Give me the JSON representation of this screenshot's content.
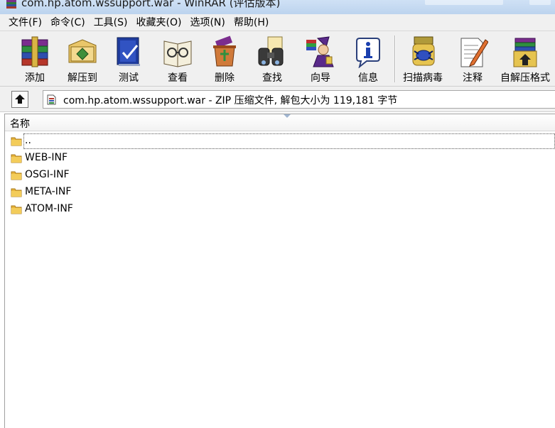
{
  "window": {
    "title": "com.hp.atom.wssupport.war - WinRAR (评估版本)"
  },
  "menu": {
    "items": [
      {
        "label": "文件(F)"
      },
      {
        "label": "命令(C)"
      },
      {
        "label": "工具(S)"
      },
      {
        "label": "收藏夹(O)"
      },
      {
        "label": "选项(N)"
      },
      {
        "label": "帮助(H)"
      }
    ]
  },
  "toolbar": {
    "buttons": [
      {
        "label": "添加",
        "icon": "add-archive-icon"
      },
      {
        "label": "解压到",
        "icon": "extract-to-icon"
      },
      {
        "label": "测试",
        "icon": "test-icon"
      },
      {
        "label": "查看",
        "icon": "view-icon"
      },
      {
        "label": "删除",
        "icon": "delete-icon"
      },
      {
        "label": "查找",
        "icon": "find-icon"
      },
      {
        "label": "向导",
        "icon": "wizard-icon"
      },
      {
        "label": "信息",
        "icon": "info-icon"
      },
      {
        "label": "扫描病毒",
        "icon": "virus-scan-icon"
      },
      {
        "label": "注释",
        "icon": "comment-icon"
      },
      {
        "label": "自解压格式",
        "icon": "sfx-icon"
      }
    ]
  },
  "address": {
    "path": "com.hp.atom.wssupport.war - ZIP 压缩文件, 解包大小为 119,181 字节"
  },
  "filelist": {
    "column_name": "名称",
    "rows": [
      {
        "name": ".."
      },
      {
        "name": "WEB-INF"
      },
      {
        "name": "OSGI-INF"
      },
      {
        "name": "META-INF"
      },
      {
        "name": "ATOM-INF"
      }
    ]
  },
  "colors": {
    "titlebar": "#c4d8f0",
    "chrome": "#f0f0f0",
    "folder": "#e8b53a"
  }
}
